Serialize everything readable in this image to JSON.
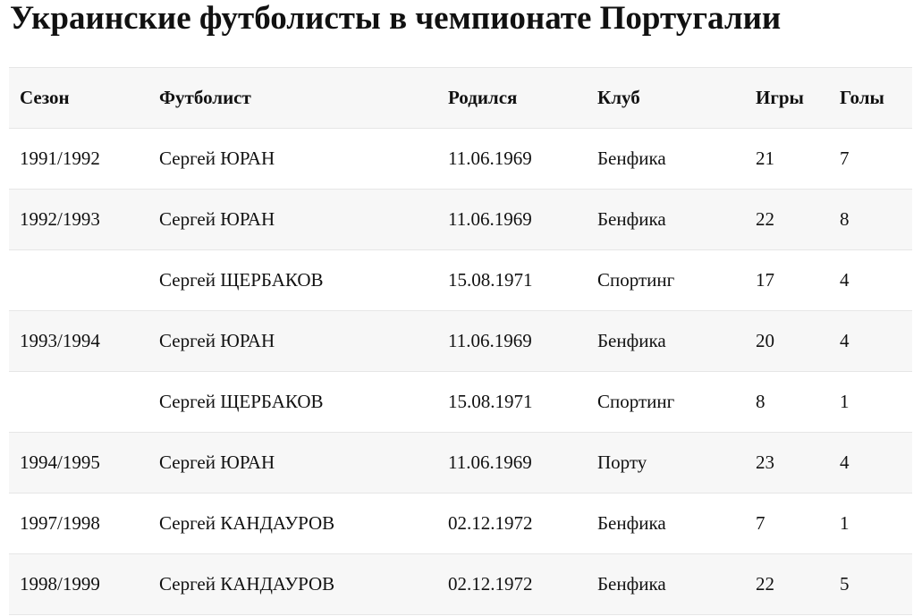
{
  "title": "Украинские футболисты в чемпионате Португалии",
  "table": {
    "headers": [
      "Сезон",
      "Футболист",
      "Родился",
      "Клуб",
      "Игры",
      "Голы"
    ],
    "rows": [
      [
        "1991/1992",
        "Сергей ЮРАН",
        "11.06.1969",
        "Бенфика",
        "21",
        "7"
      ],
      [
        "1992/1993",
        "Сергей ЮРАН",
        "11.06.1969",
        "Бенфика",
        "22",
        "8"
      ],
      [
        "",
        "Сергей ЩЕРБАКОВ",
        "15.08.1971",
        "Спортинг",
        "17",
        "4"
      ],
      [
        "1993/1994",
        "Сергей ЮРАН",
        "11.06.1969",
        "Бенфика",
        "20",
        "4"
      ],
      [
        "",
        "Сергей ЩЕРБАКОВ",
        "15.08.1971",
        "Спортинг",
        "8",
        "1"
      ],
      [
        "1994/1995",
        "Сергей ЮРАН",
        "11.06.1969",
        "Порту",
        "23",
        "4"
      ],
      [
        "1997/1998",
        "Сергей КАНДАУРОВ",
        "02.12.1972",
        "Бенфика",
        "7",
        "1"
      ],
      [
        "1998/1999",
        "Сергей КАНДАУРОВ",
        "02.12.1972",
        "Бенфика",
        "22",
        "5"
      ]
    ]
  }
}
